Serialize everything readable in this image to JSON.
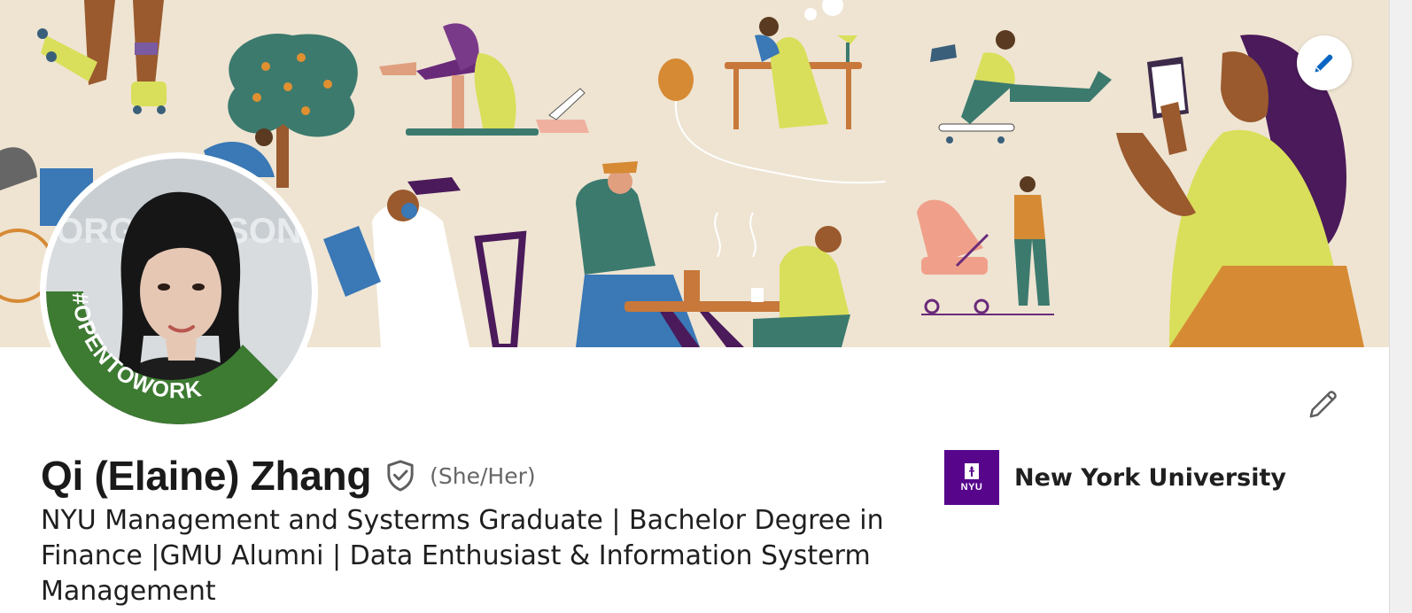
{
  "profile": {
    "name": "Qi (Elaine) Zhang",
    "pronouns": "(She/Her)",
    "headline": "NYU Management and Systerms Graduate | Bachelor Degree in Finance |GMU Alumni | Data Enthusiast & Information Systerm Management",
    "open_to_work_badge": "#OPENTOWORK",
    "avatar_bg_text": "ORGE MASON"
  },
  "education": {
    "school_name": "New York University",
    "logo_text": "NYU"
  },
  "icons": {
    "banner_edit": "pencil-icon",
    "intro_edit": "pencil-icon",
    "verified": "shield-check-icon"
  },
  "colors": {
    "banner_bg": "#efe4d2",
    "open_to_work_green": "#3d7a32",
    "edit_icon_blue": "#0a66c2",
    "nyu_purple": "#57068c"
  }
}
